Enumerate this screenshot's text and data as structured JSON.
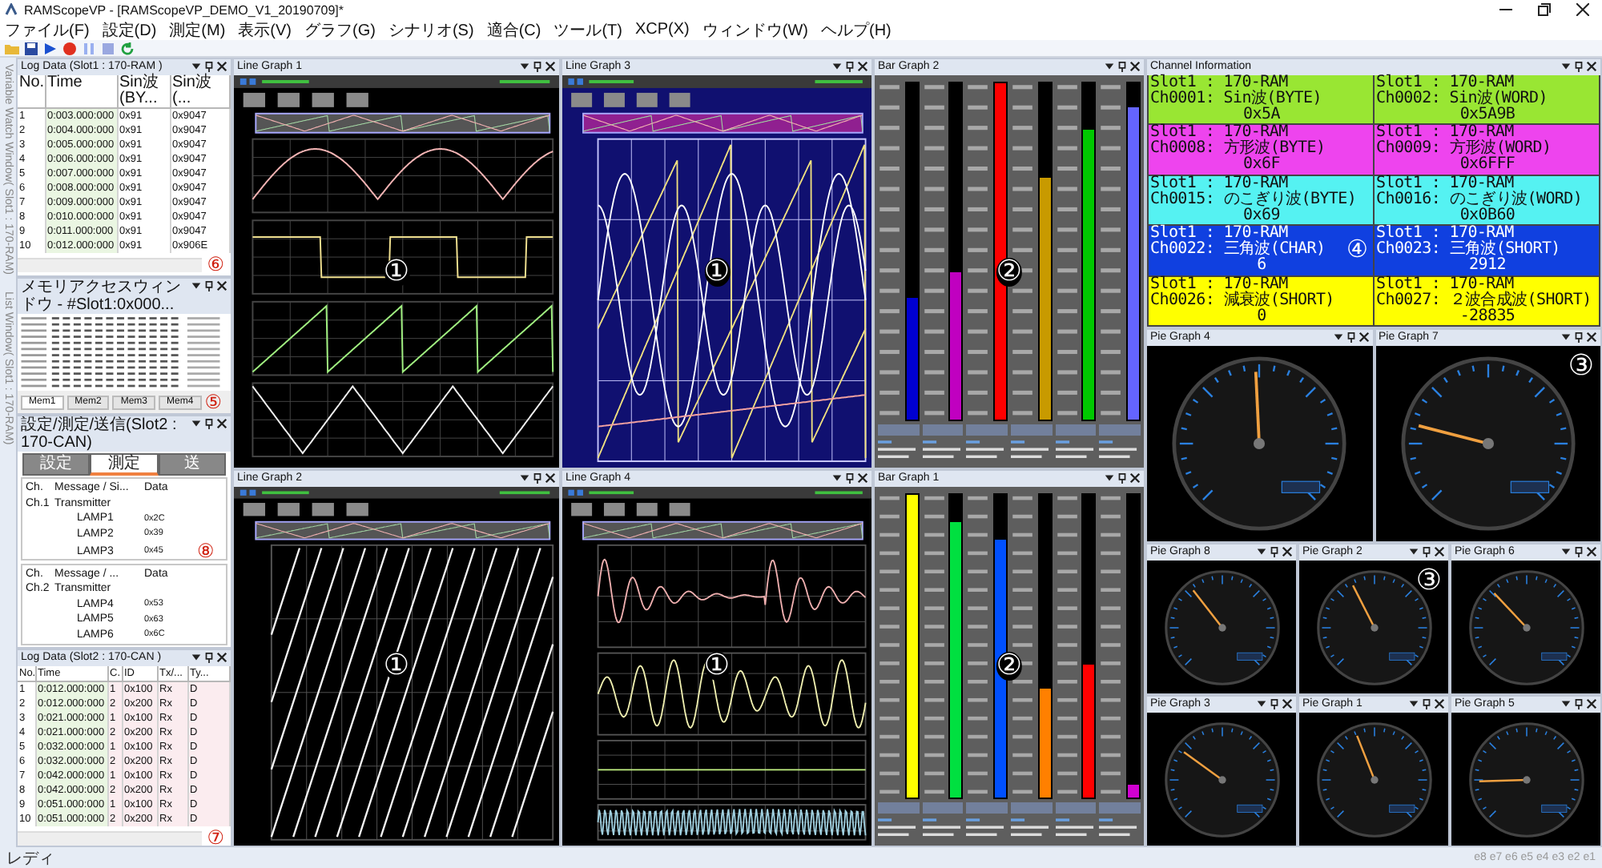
{
  "window": {
    "title": "RAMScopeVP - [RAMScopeVP_DEMO_V1_20190709]*"
  },
  "menu": [
    "ファイル(F)",
    "設定(D)",
    "測定(M)",
    "表示(V)",
    "グラフ(G)",
    "シナリオ(S)",
    "適合(C)",
    "ツール(T)",
    "XCP(X)",
    "ウィンドウ(W)",
    "ヘルプ(H)"
  ],
  "side_tabs": [
    "Variable Watch Window( Slot1 : 170-RAM)",
    "List Window( Slot1 : 170-RAM)"
  ],
  "log_data_1": {
    "title": "Log Data (Slot1 : 170-RAM )",
    "marker": "⑥",
    "columns": [
      "No.",
      "Time",
      "Sin波(BY...",
      "Sin波(..."
    ],
    "rows": [
      [
        "1",
        "0:003.000:000",
        "0x91",
        "0x9047"
      ],
      [
        "2",
        "0:004.000:000",
        "0x91",
        "0x9047"
      ],
      [
        "3",
        "0:005.000:000",
        "0x91",
        "0x9047"
      ],
      [
        "4",
        "0:006.000:000",
        "0x91",
        "0x9047"
      ],
      [
        "5",
        "0:007.000:000",
        "0x91",
        "0x9047"
      ],
      [
        "6",
        "0:008.000:000",
        "0x91",
        "0x9047"
      ],
      [
        "7",
        "0:009.000:000",
        "0x91",
        "0x9047"
      ],
      [
        "8",
        "0:010.000:000",
        "0x91",
        "0x9047"
      ],
      [
        "9",
        "0:011.000:000",
        "0x91",
        "0x9047"
      ],
      [
        "10",
        "0:012.000:000",
        "0x91",
        "0x906E"
      ]
    ]
  },
  "memory_window": {
    "title": "メモリアクセスウィンドウ - #Slot1:0x000...",
    "marker": "⑤",
    "tabs": [
      {
        "label": "Mem1",
        "selected": true
      },
      {
        "label": "Mem2",
        "selected": false
      },
      {
        "label": "Mem3",
        "selected": false
      },
      {
        "label": "Mem4",
        "selected": false
      }
    ]
  },
  "transmit_panel": {
    "title": "設定/測定/送信(Slot2 : 170-CAN)",
    "marker": "⑧",
    "tabs": [
      {
        "label": "設定",
        "selected": false
      },
      {
        "label": "測定",
        "selected": true
      },
      {
        "label": "送",
        "selected": false
      }
    ],
    "trees": [
      {
        "columns": [
          "Ch.",
          "Message / Si...",
          "Data"
        ],
        "channel": "Ch.1",
        "message": "Transmitter",
        "children": [
          {
            "label": "LAMP1",
            "data": "0x2C"
          },
          {
            "label": "LAMP2",
            "data": "0x39"
          },
          {
            "label": "LAMP3",
            "data": "0x45"
          }
        ]
      },
      {
        "columns": [
          "Ch.",
          "Message / ...",
          "Data"
        ],
        "channel": "Ch.2",
        "message": "Transmitter",
        "children": [
          {
            "label": "LAMP4",
            "data": "0x53"
          },
          {
            "label": "LAMP5",
            "data": "0x63"
          },
          {
            "label": "LAMP6",
            "data": "0x6C"
          }
        ]
      }
    ]
  },
  "log_data_2": {
    "title": "Log Data (Slot2 : 170-CAN )",
    "marker": "⑦",
    "columns": [
      "No.",
      "Time",
      "C.",
      "ID",
      "Tx/...",
      "Ty..."
    ],
    "rows": [
      [
        "1",
        "0:012.000:000",
        "1",
        "0x100",
        "Rx",
        "D"
      ],
      [
        "2",
        "0:012.000:000",
        "2",
        "0x200",
        "Rx",
        "D"
      ],
      [
        "3",
        "0:021.000:000",
        "1",
        "0x100",
        "Rx",
        "D"
      ],
      [
        "4",
        "0:021.000:000",
        "2",
        "0x200",
        "Rx",
        "D"
      ],
      [
        "5",
        "0:032.000:000",
        "1",
        "0x100",
        "Rx",
        "D"
      ],
      [
        "6",
        "0:032.000:000",
        "2",
        "0x200",
        "Rx",
        "D"
      ],
      [
        "7",
        "0:042.000:000",
        "1",
        "0x100",
        "Rx",
        "D"
      ],
      [
        "8",
        "0:042.000:000",
        "2",
        "0x200",
        "Rx",
        "D"
      ],
      [
        "9",
        "0:051.000:000",
        "1",
        "0x100",
        "Rx",
        "D"
      ],
      [
        "10",
        "0:051.000:000",
        "2",
        "0x200",
        "Rx",
        "D"
      ]
    ]
  },
  "graphs": [
    {
      "title": "Line Graph 1",
      "kind": "multi",
      "marker": "①"
    },
    {
      "title": "Line Graph 3",
      "kind": "overlay",
      "marker": "①"
    },
    {
      "title": "Bar Graph 2",
      "kind": "bar",
      "marker": "②",
      "bars": [
        {
          "level": 0.36,
          "color": "#0000d0"
        },
        {
          "level": 0.44,
          "color": "#c000c0"
        },
        {
          "level": 1.0,
          "color": "#ff0000"
        },
        {
          "level": 0.72,
          "color": "#c89a00"
        },
        {
          "level": 0.86,
          "color": "#00c800"
        },
        {
          "level": 0.93,
          "color": "#6464ff"
        }
      ]
    },
    {
      "title": "Line Graph 2",
      "kind": "diagonal",
      "marker": "①"
    },
    {
      "title": "Line Graph 4",
      "kind": "damped",
      "marker": "①"
    },
    {
      "title": "Bar Graph 1",
      "kind": "bar",
      "marker": "②",
      "bars": [
        {
          "level": 1.0,
          "color": "#ffff00"
        },
        {
          "level": 0.91,
          "color": "#00e040"
        },
        {
          "level": 0.85,
          "color": "#0050ff"
        },
        {
          "level": 0.36,
          "color": "#ff8000"
        },
        {
          "level": 0.44,
          "color": "#ff0000"
        },
        {
          "level": 0.04,
          "color": "#d000d0"
        }
      ]
    }
  ],
  "channel_info": {
    "title": "Channel Information",
    "cells": [
      {
        "slot": "Slot1 : 170-RAM",
        "channel": "Ch0001: Sin波(BYTE)",
        "value": "0x5A",
        "color": "#99e633"
      },
      {
        "slot": "Slot1 : 170-RAM",
        "channel": "Ch0002: Sin波(WORD)",
        "value": "0x5A9B",
        "color": "#99e633"
      },
      {
        "slot": "Slot1 : 170-RAM",
        "channel": "Ch0008: 方形波(BYTE)",
        "value": "0x6F",
        "color": "#ee44ee"
      },
      {
        "slot": "Slot1 : 170-RAM",
        "channel": "Ch0009: 方形波(WORD)",
        "value": "0x6FFF",
        "color": "#ee44ee"
      },
      {
        "slot": "Slot1 : 170-RAM",
        "channel": "Ch0015: のこぎり波(BYTE)",
        "value": "0x69",
        "color": "#55f2f2"
      },
      {
        "slot": "Slot1 : 170-RAM",
        "channel": "Ch0016: のこぎり波(WORD)",
        "value": "0x0B60",
        "color": "#55f2f2"
      },
      {
        "slot": "Slot1 : 170-RAM",
        "channel": "Ch0022: 三角波(CHAR)",
        "value": "6",
        "color": "#1040e0",
        "marker": "④"
      },
      {
        "slot": "Slot1 : 170-RAM",
        "channel": "Ch0023: 三角波(SHORT)",
        "value": "2912",
        "color": "#1040e0"
      },
      {
        "slot": "Slot1 : 170-RAM",
        "channel": "Ch0026: 減衰波(SHORT)",
        "value": "0",
        "color": "#ffff00"
      },
      {
        "slot": "Slot1 : 170-RAM",
        "channel": "Ch0027: ２波合成波(SHORT)",
        "value": "-28835",
        "color": "#ffff00"
      }
    ]
  },
  "gauges_large": [
    {
      "title": "Pie Graph 4",
      "level": 0.49
    },
    {
      "title": "Pie Graph 7",
      "level": 0.22,
      "marker": "③"
    }
  ],
  "gauges_small": [
    {
      "title": "Pie Graph 8",
      "level": 0.36
    },
    {
      "title": "Pie Graph 2",
      "level": 0.4,
      "marker": "③"
    },
    {
      "title": "Pie Graph 6",
      "level": 0.34
    },
    {
      "title": "Pie Graph 3",
      "level": 0.3
    },
    {
      "title": "Pie Graph 1",
      "level": 0.42
    },
    {
      "title": "Pie Graph 5",
      "level": 0.16
    }
  ],
  "status_bar": {
    "text": "レディ",
    "indicators": "e8 e7 e6 e5 e4 e3 e2 e1"
  }
}
